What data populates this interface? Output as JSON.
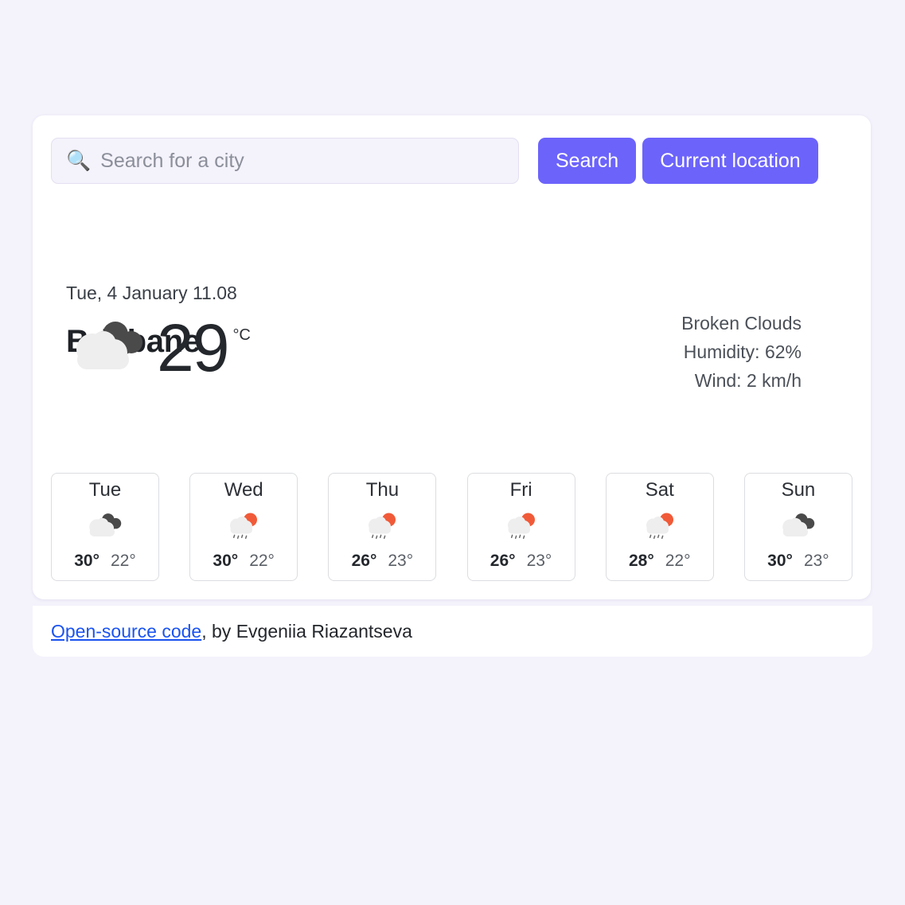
{
  "theme": {
    "page_background": "#f4f2fb",
    "card_background": "#ffffff",
    "accent": "#6c63fb",
    "link_color": "#1a53f0",
    "text_primary": "#24282d",
    "text_secondary": "#4b5058"
  },
  "search": {
    "icon": "search-icon",
    "icon_glyph": "🔍",
    "value": "",
    "placeholder": "Search for a city",
    "search_button_label": "Search",
    "location_button_label": "Current location"
  },
  "current": {
    "city": "Brisbane",
    "datetime": "Tue, 4 January 11.08",
    "temperature": "29",
    "unit": "°C",
    "icon": "broken-clouds-icon",
    "description": "Broken Clouds",
    "humidity": "Humidity: 62%",
    "wind": "Wind: 2 km/h"
  },
  "forecast": [
    {
      "day": "Tue",
      "icon": "broken-clouds-icon",
      "max": "30°",
      "min": "22°"
    },
    {
      "day": "Wed",
      "icon": "rain-sun-icon",
      "max": "30°",
      "min": "22°"
    },
    {
      "day": "Thu",
      "icon": "rain-sun-icon",
      "max": "26°",
      "min": "23°"
    },
    {
      "day": "Fri",
      "icon": "rain-sun-icon",
      "max": "26°",
      "min": "23°"
    },
    {
      "day": "Sat",
      "icon": "rain-sun-icon",
      "max": "28°",
      "min": "22°"
    },
    {
      "day": "Sun",
      "icon": "broken-clouds-icon",
      "max": "30°",
      "min": "23°"
    }
  ],
  "footer": {
    "link_label": "Open-source code",
    "rest": ", by Evgeniia Riazantseva"
  }
}
